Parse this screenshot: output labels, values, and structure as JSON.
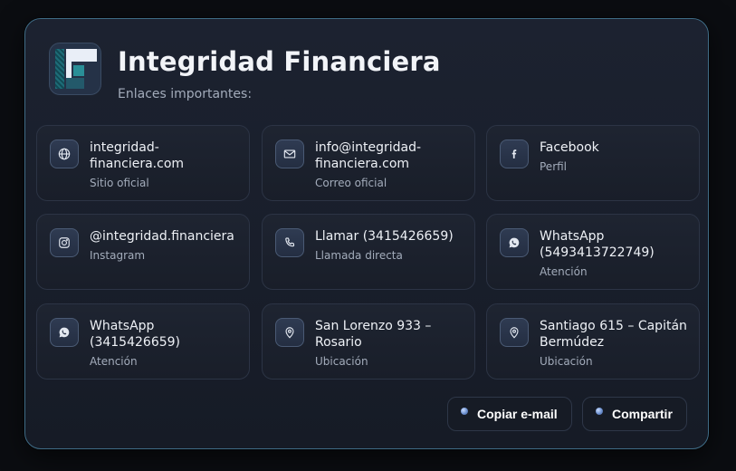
{
  "header": {
    "title": "Integridad Financiera",
    "subtitle": "Enlaces importantes:"
  },
  "items": [
    {
      "title": "integridad-financiera.com",
      "subtitle": "Sitio oficial",
      "icon": "globe-icon"
    },
    {
      "title": "info@integridad-financiera.com",
      "subtitle": "Correo oficial",
      "icon": "mail-icon"
    },
    {
      "title": "Facebook",
      "subtitle": "Perfil",
      "icon": "facebook-icon"
    },
    {
      "title": "@integridad.financiera",
      "subtitle": "Instagram",
      "icon": "instagram-icon"
    },
    {
      "title": "Llamar (3415426659)",
      "subtitle": "Llamada directa",
      "icon": "phone-icon"
    },
    {
      "title": "WhatsApp (5493413722749)",
      "subtitle": "Atención",
      "icon": "whatsapp-icon"
    },
    {
      "title": "WhatsApp (3415426659)",
      "subtitle": "Atención",
      "icon": "whatsapp-icon"
    },
    {
      "title": "San Lorenzo 933 – Rosario",
      "subtitle": "Ubicación",
      "icon": "location-pin-icon"
    },
    {
      "title": "Santiago 615 – Capitán Bermúdez",
      "subtitle": "Ubicación",
      "icon": "location-pin-icon"
    }
  ],
  "actions": {
    "copy_email": "Copiar e-mail",
    "share": "Compartir"
  },
  "colors": {
    "background": "#0b0d11",
    "card": "#1a202c",
    "card_border": "#3f6c86",
    "accent_icon": "#e3e8f0"
  }
}
